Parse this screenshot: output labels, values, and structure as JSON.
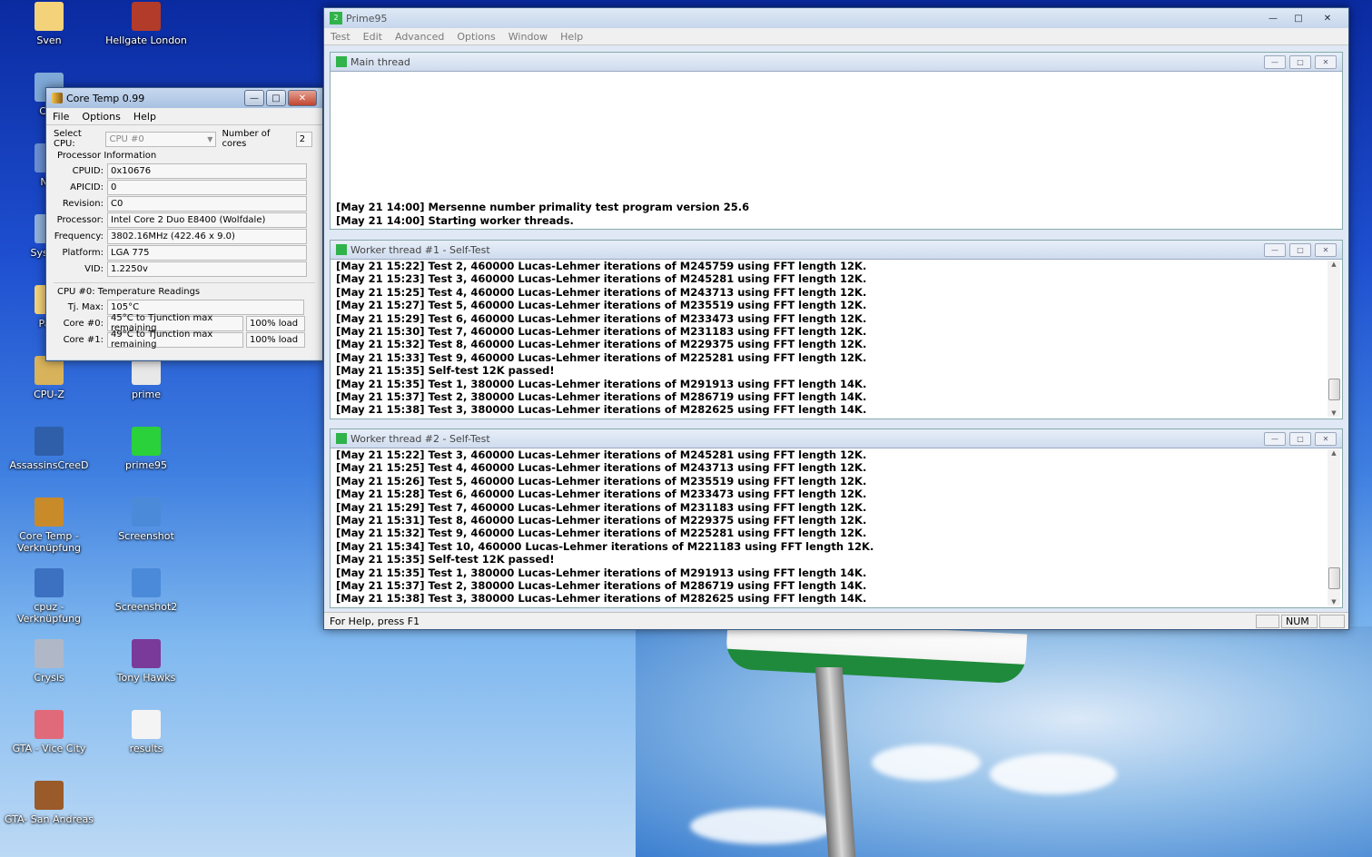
{
  "desktop": {
    "icons_left": [
      {
        "label": "Sven"
      },
      {
        "label": "Con"
      },
      {
        "label": "Net"
      },
      {
        "label": "System"
      },
      {
        "label": "Papi"
      },
      {
        "label": "CPU-Z"
      },
      {
        "label": "AssassinsCreeD"
      },
      {
        "label": "Core Temp - Verknüpfung"
      },
      {
        "label": "cpuz - Verknüpfung"
      },
      {
        "label": "Crysis"
      },
      {
        "label": "GTA - Vice City"
      },
      {
        "label": "GTA- San Andreas"
      }
    ],
    "icons_right": [
      {
        "label": "Hellgate London"
      },
      {
        "label": "prime"
      },
      {
        "label": "prime95"
      },
      {
        "label": "Screenshot"
      },
      {
        "label": "Screenshot2"
      },
      {
        "label": "Tony Hawks"
      },
      {
        "label": "results"
      }
    ],
    "prime95_icon_text": "2P-1"
  },
  "coretemp": {
    "title": "Core Temp 0.99",
    "menu": [
      "File",
      "Options",
      "Help"
    ],
    "select_cpu_label": "Select CPU:",
    "select_cpu_value": "CPU #0",
    "num_cores_label": "Number of cores",
    "num_cores_value": "2",
    "proc_info_title": "Processor Information",
    "fields": [
      {
        "label": "CPUID:",
        "value": "0x10676"
      },
      {
        "label": "APICID:",
        "value": "0"
      },
      {
        "label": "Revision:",
        "value": "C0"
      },
      {
        "label": "Processor:",
        "value": "Intel Core 2 Duo E8400 (Wolfdale)"
      },
      {
        "label": "Frequency:",
        "value": "3802.16MHz (422.46 x 9.0)"
      },
      {
        "label": "Platform:",
        "value": "LGA 775"
      },
      {
        "label": "VID:",
        "value": "1.2250v"
      }
    ],
    "temp_title": "CPU #0: Temperature Readings",
    "tjmax_label": "Tj. Max:",
    "tjmax_value": "105°C",
    "cores": [
      {
        "label": "Core #0:",
        "temp": "45°C to Tjunction max remaining",
        "load": "100% load"
      },
      {
        "label": "Core #1:",
        "temp": "49°C to Tjunction max remaining",
        "load": "100% load"
      }
    ]
  },
  "prime95": {
    "title": "Prime95",
    "menu": [
      "Test",
      "Edit",
      "Advanced",
      "Options",
      "Window",
      "Help"
    ],
    "main_thread": {
      "title": "Main thread",
      "lines": [
        "[May 21 14:00] Mersenne number primality test program version 25.6",
        "[May 21 14:00] Starting worker threads."
      ]
    },
    "worker1": {
      "title": "Worker thread #1 - Self-Test",
      "lines": [
        "[May 21 15:22] Test 2, 460000 Lucas-Lehmer iterations of M245759 using FFT length 12K.",
        "[May 21 15:23] Test 3, 460000 Lucas-Lehmer iterations of M245281 using FFT length 12K.",
        "[May 21 15:25] Test 4, 460000 Lucas-Lehmer iterations of M243713 using FFT length 12K.",
        "[May 21 15:27] Test 5, 460000 Lucas-Lehmer iterations of M235519 using FFT length 12K.",
        "[May 21 15:29] Test 6, 460000 Lucas-Lehmer iterations of M233473 using FFT length 12K.",
        "[May 21 15:30] Test 7, 460000 Lucas-Lehmer iterations of M231183 using FFT length 12K.",
        "[May 21 15:32] Test 8, 460000 Lucas-Lehmer iterations of M229375 using FFT length 12K.",
        "[May 21 15:33] Test 9, 460000 Lucas-Lehmer iterations of M225281 using FFT length 12K.",
        "[May 21 15:35] Self-test 12K passed!",
        "[May 21 15:35] Test 1, 380000 Lucas-Lehmer iterations of M291913 using FFT length 14K.",
        "[May 21 15:37] Test 2, 380000 Lucas-Lehmer iterations of M286719 using FFT length 14K.",
        "[May 21 15:38] Test 3, 380000 Lucas-Lehmer iterations of M282625 using FFT length 14K."
      ]
    },
    "worker2": {
      "title": "Worker thread #2 - Self-Test",
      "lines": [
        "[May 21 15:22] Test 3, 460000 Lucas-Lehmer iterations of M245281 using FFT length 12K.",
        "[May 21 15:25] Test 4, 460000 Lucas-Lehmer iterations of M243713 using FFT length 12K.",
        "[May 21 15:26] Test 5, 460000 Lucas-Lehmer iterations of M235519 using FFT length 12K.",
        "[May 21 15:28] Test 6, 460000 Lucas-Lehmer iterations of M233473 using FFT length 12K.",
        "[May 21 15:29] Test 7, 460000 Lucas-Lehmer iterations of M231183 using FFT length 12K.",
        "[May 21 15:31] Test 8, 460000 Lucas-Lehmer iterations of M229375 using FFT length 12K.",
        "[May 21 15:32] Test 9, 460000 Lucas-Lehmer iterations of M225281 using FFT length 12K.",
        "[May 21 15:34] Test 10, 460000 Lucas-Lehmer iterations of M221183 using FFT length 12K.",
        "[May 21 15:35] Self-test 12K passed!",
        "[May 21 15:35] Test 1, 380000 Lucas-Lehmer iterations of M291913 using FFT length 14K.",
        "[May 21 15:37] Test 2, 380000 Lucas-Lehmer iterations of M286719 using FFT length 14K.",
        "[May 21 15:38] Test 3, 380000 Lucas-Lehmer iterations of M282625 using FFT length 14K."
      ]
    },
    "status_help": "For Help, press F1",
    "status_num": "NUM"
  }
}
